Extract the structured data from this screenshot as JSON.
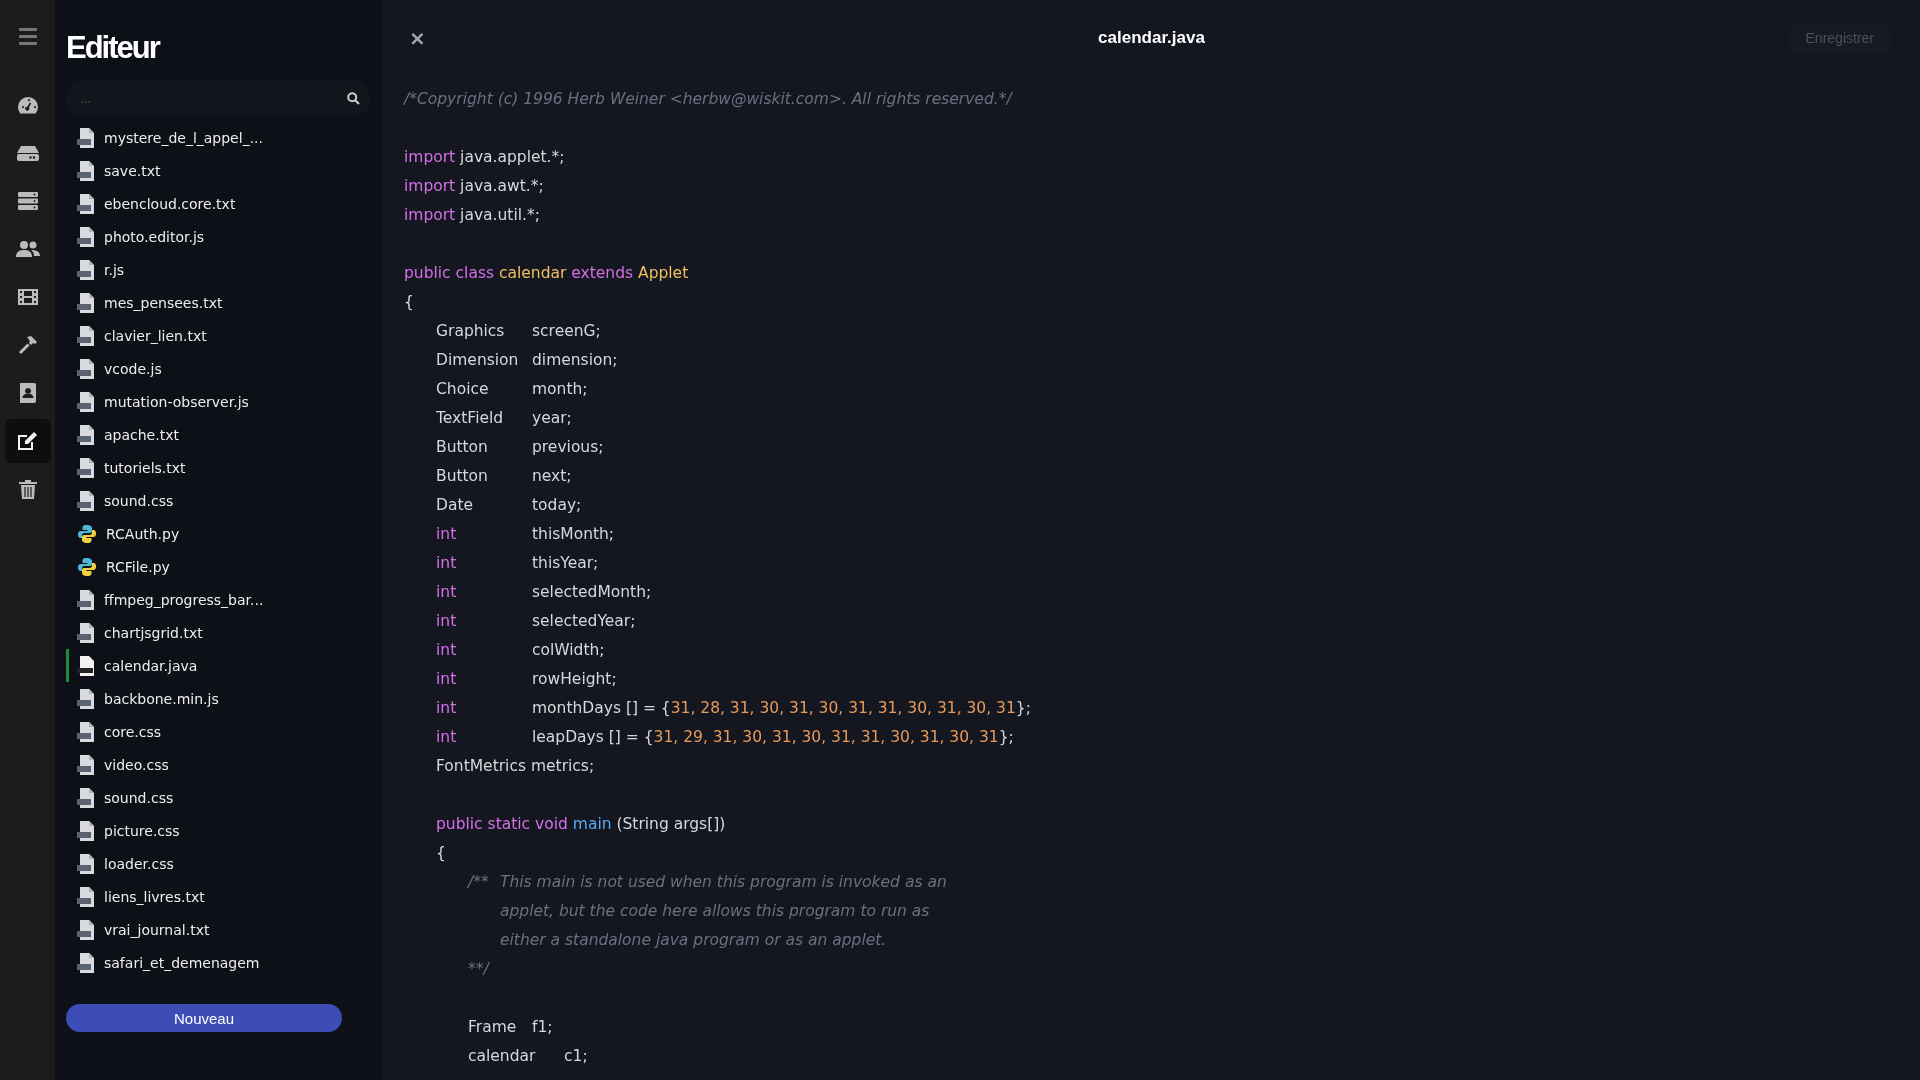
{
  "nav": [
    {
      "selected": false
    },
    {
      "selected": false
    },
    {
      "selected": false
    },
    {
      "selected": false
    },
    {
      "selected": false
    },
    {
      "selected": false
    },
    {
      "selected": false
    },
    {
      "selected": true
    },
    {
      "selected": false
    }
  ],
  "sidebar": {
    "title": "Editeur",
    "search": {
      "placeholder": "..."
    },
    "files": [
      {
        "name": "mystere_de_l_appel_...",
        "kind": "txt",
        "selected": false
      },
      {
        "name": "save.txt",
        "kind": "txt",
        "selected": false
      },
      {
        "name": "ebencloud.core.txt",
        "kind": "txt",
        "selected": false
      },
      {
        "name": "photo.editor.js",
        "kind": "js",
        "selected": false
      },
      {
        "name": "r.js",
        "kind": "js",
        "selected": false
      },
      {
        "name": "mes_pensees.txt",
        "kind": "txt",
        "selected": false
      },
      {
        "name": "clavier_lien.txt",
        "kind": "txt",
        "selected": false
      },
      {
        "name": "vcode.js",
        "kind": "js",
        "selected": false
      },
      {
        "name": "mutation-observer.js",
        "kind": "js",
        "selected": false
      },
      {
        "name": "apache.txt",
        "kind": "txt",
        "selected": false
      },
      {
        "name": "tutoriels.txt",
        "kind": "txt",
        "selected": false
      },
      {
        "name": "sound.css",
        "kind": "css",
        "selected": false
      },
      {
        "name": "RCAuth.py",
        "kind": "py",
        "selected": false
      },
      {
        "name": "RCFile.py",
        "kind": "py",
        "selected": false
      },
      {
        "name": "ffmpeg_progress_bar...",
        "kind": "txt",
        "selected": false
      },
      {
        "name": "chartjsgrid.txt",
        "kind": "txt",
        "selected": false
      },
      {
        "name": "calendar.java",
        "kind": "java",
        "selected": true
      },
      {
        "name": "backbone.min.js",
        "kind": "js",
        "selected": false
      },
      {
        "name": "core.css",
        "kind": "css",
        "selected": false
      },
      {
        "name": "video.css",
        "kind": "css",
        "selected": false
      },
      {
        "name": "sound.css",
        "kind": "css",
        "selected": false
      },
      {
        "name": "picture.css",
        "kind": "css",
        "selected": false
      },
      {
        "name": "loader.css",
        "kind": "css",
        "selected": false
      },
      {
        "name": "liens_livres.txt",
        "kind": "txt",
        "selected": false
      },
      {
        "name": "vrai_journal.txt",
        "kind": "txt",
        "selected": false
      },
      {
        "name": "safari_et_demenagem",
        "kind": "txt",
        "selected": false
      }
    ],
    "new_button": "Nouveau"
  },
  "editor": {
    "close": "×",
    "title": "calendar.java",
    "save_button": "Enregistrer",
    "code": [
      {
        "kind": "line",
        "tokens": [
          {
            "kind": "comment",
            "text": "/*Copyright (c) 1996 Herb Weiner <herbw@wiskit.com>. All rights reserved.*/"
          }
        ]
      },
      {
        "kind": "blank"
      },
      {
        "kind": "line",
        "tokens": [
          {
            "kind": "keyword",
            "text": "import"
          },
          {
            "kind": "plain",
            "text": " java.applet.*;"
          }
        ]
      },
      {
        "kind": "line",
        "tokens": [
          {
            "kind": "keyword",
            "text": "import"
          },
          {
            "kind": "plain",
            "text": " java.awt.*;"
          }
        ]
      },
      {
        "kind": "line",
        "tokens": [
          {
            "kind": "keyword",
            "text": "import"
          },
          {
            "kind": "plain",
            "text": " java.util.*;"
          }
        ]
      },
      {
        "kind": "blank"
      },
      {
        "kind": "line",
        "tokens": [
          {
            "kind": "keyword",
            "text": "public class "
          },
          {
            "kind": "type",
            "text": "calendar"
          },
          {
            "kind": "keyword",
            "text": " extends "
          },
          {
            "kind": "type",
            "text": "Applet"
          }
        ]
      },
      {
        "kind": "line",
        "tokens": [
          {
            "kind": "plain",
            "text": "{"
          }
        ],
        "children": [
          {
            "kind": "line",
            "tokens": [
              {
                "kind": "plain",
                "text": "Graphics\tscreenG;"
              }
            ]
          },
          {
            "kind": "line",
            "tokens": [
              {
                "kind": "plain",
                "text": "Dimension\tdimension;"
              }
            ]
          },
          {
            "kind": "line",
            "tokens": [
              {
                "kind": "plain",
                "text": "Choice\t\tmonth;"
              }
            ]
          },
          {
            "kind": "line",
            "tokens": [
              {
                "kind": "plain",
                "text": "TextField\tyear;"
              }
            ]
          },
          {
            "kind": "line",
            "tokens": [
              {
                "kind": "plain",
                "text": "Button\t\tprevious;"
              }
            ]
          },
          {
            "kind": "line",
            "tokens": [
              {
                "kind": "plain",
                "text": "Button\t\tnext;"
              }
            ]
          },
          {
            "kind": "line",
            "tokens": [
              {
                "kind": "plain",
                "text": "Date\t\ttoday;"
              }
            ]
          },
          {
            "kind": "line",
            "tokens": [
              {
                "kind": "keyword",
                "text": "int"
              },
              {
                "kind": "plain",
                "text": "\t\t\tthisMonth;"
              }
            ]
          },
          {
            "kind": "line",
            "tokens": [
              {
                "kind": "keyword",
                "text": "int"
              },
              {
                "kind": "plain",
                "text": "\t\t\tthisYear;"
              }
            ]
          },
          {
            "kind": "line",
            "tokens": [
              {
                "kind": "keyword",
                "text": "int"
              },
              {
                "kind": "plain",
                "text": "\t\t\tselectedMonth;"
              }
            ]
          },
          {
            "kind": "line",
            "tokens": [
              {
                "kind": "keyword",
                "text": "int"
              },
              {
                "kind": "plain",
                "text": "\t\t\tselectedYear;"
              }
            ]
          },
          {
            "kind": "line",
            "tokens": [
              {
                "kind": "keyword",
                "text": "int"
              },
              {
                "kind": "plain",
                "text": "\t\t\tcolWidth;"
              }
            ]
          },
          {
            "kind": "line",
            "tokens": [
              {
                "kind": "keyword",
                "text": "int"
              },
              {
                "kind": "plain",
                "text": "\t\t\trowHeight;"
              }
            ]
          },
          {
            "kind": "line",
            "tokens": [
              {
                "kind": "keyword",
                "text": "int"
              },
              {
                "kind": "plain",
                "text": "\t\t\tmonthDays [] = {"
              },
              {
                "kind": "number",
                "text": "31, 28, 31, 30, 31, 30, 31, 31, 30, 31, 30, 31"
              },
              {
                "kind": "plain",
                "text": "};"
              }
            ]
          },
          {
            "kind": "line",
            "tokens": [
              {
                "kind": "keyword",
                "text": "int"
              },
              {
                "kind": "plain",
                "text": "\t\t\tleapDays [] = {"
              },
              {
                "kind": "number",
                "text": "31, 29, 31, 30, 31, 30, 31, 31, 30, 31, 30, 31"
              },
              {
                "kind": "plain",
                "text": "};"
              }
            ]
          },
          {
            "kind": "line",
            "tokens": [
              {
                "kind": "plain",
                "text": "FontMetrics metrics;"
              }
            ]
          },
          {
            "kind": "blank"
          },
          {
            "kind": "line",
            "tokens": [
              {
                "kind": "keyword",
                "text": "public static void "
              },
              {
                "kind": "function",
                "text": "main"
              },
              {
                "kind": "plain",
                "text": " (String args[])"
              }
            ]
          },
          {
            "kind": "line",
            "tokens": [
              {
                "kind": "plain",
                "text": "{"
              }
            ],
            "children": [
              {
                "kind": "line",
                "tokens": [
                  {
                    "kind": "comment",
                    "text": "/**\tThis main is not used when this program is invoked as an"
                  }
                ]
              },
              {
                "kind": "line",
                "tokens": [
                  {
                    "kind": "comment",
                    "text": "\tapplet, but the code here allows this program to run as"
                  }
                ]
              },
              {
                "kind": "line",
                "tokens": [
                  {
                    "kind": "comment",
                    "text": "\teither a standalone java program or as an applet."
                  }
                ]
              },
              {
                "kind": "line",
                "tokens": [
                  {
                    "kind": "comment",
                    "text": "**/"
                  }
                ]
              },
              {
                "kind": "blank"
              },
              {
                "kind": "line",
                "tokens": [
                  {
                    "kind": "plain",
                    "text": "Frame\tf1;"
                  }
                ]
              },
              {
                "kind": "line",
                "tokens": [
                  {
                    "kind": "plain",
                    "text": "calendar\tc1;"
                  }
                ]
              }
            ]
          }
        ]
      }
    ]
  }
}
